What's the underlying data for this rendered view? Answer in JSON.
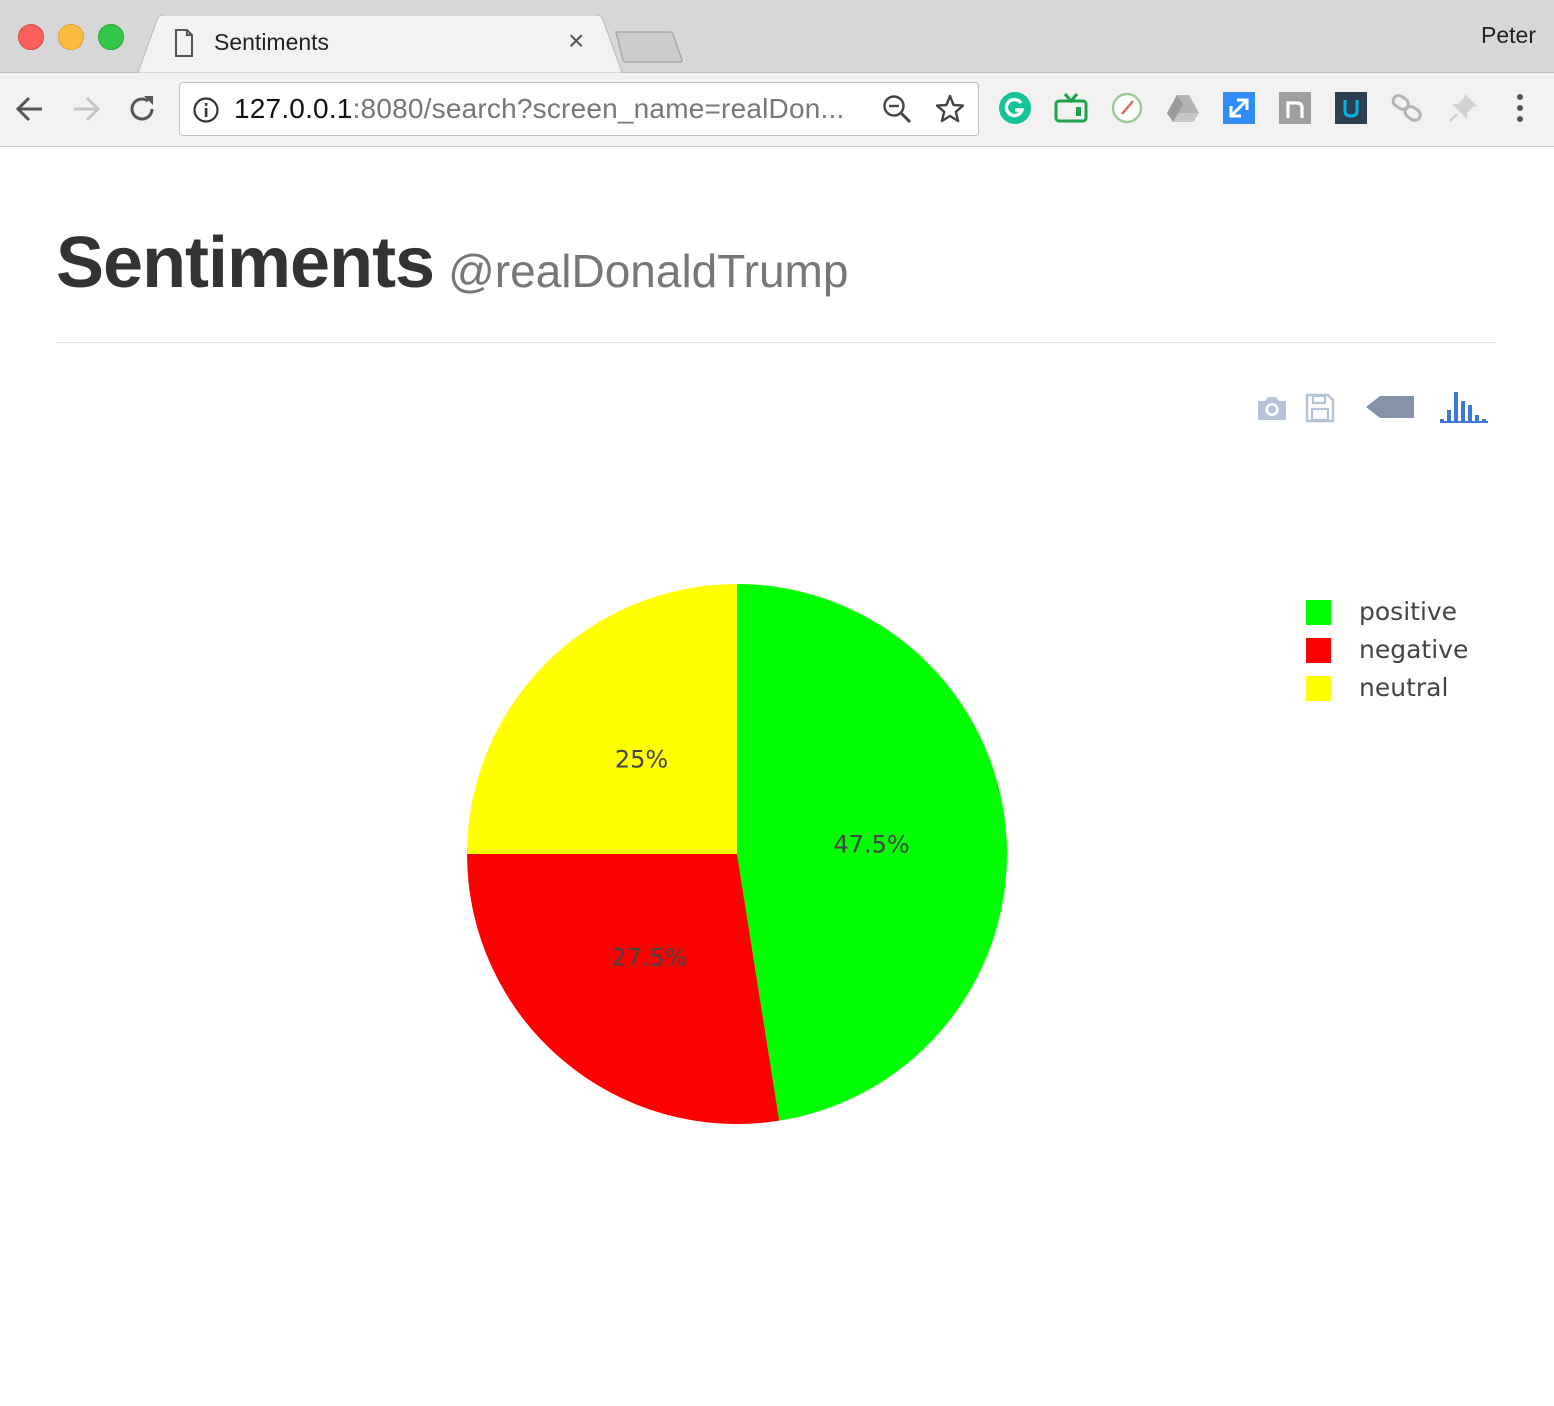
{
  "browser": {
    "tab_title": "Sentiments",
    "tab_close": "×",
    "profile_name": "Peter",
    "url_host": "127.0.0.1",
    "url_rest": ":8080/search?screen_name=realDon...",
    "extensions": [
      "grammarly-icon",
      "tv-icon",
      "speed-dial-icon",
      "drive-icon",
      "resize-icon",
      "notion-icon",
      "udacity-icon",
      "link-icon",
      "pin-icon"
    ]
  },
  "page": {
    "title": "Sentiments",
    "subtitle": "@realDonaldTrump"
  },
  "modebar": [
    "camera-icon",
    "save-icon",
    "plotly-logo-icon",
    "bar-chart-icon"
  ],
  "chart_data": {
    "type": "pie",
    "categories": [
      "positive",
      "negative",
      "neutral"
    ],
    "values": [
      47.5,
      27.5,
      25
    ],
    "labels": [
      "47.5%",
      "27.5%",
      "25%"
    ],
    "colors": [
      "#00ff00",
      "#ff0000",
      "#ffff00"
    ],
    "legend": "top-right",
    "direction": "clockwise",
    "rotation_start": "top"
  }
}
